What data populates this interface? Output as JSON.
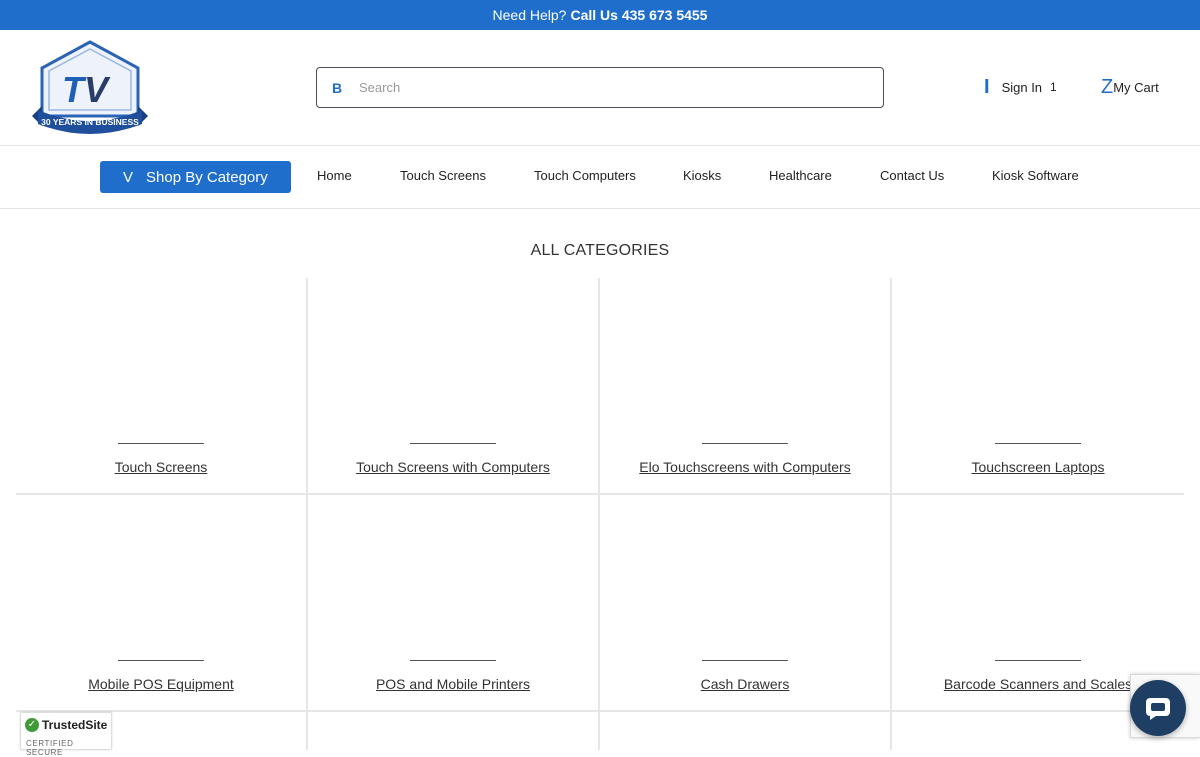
{
  "topbar": {
    "help_text": "Need Help?",
    "phone_text": "Call Us 435 673 5455"
  },
  "header": {
    "logo_text": "30 YEARS IN BUSINESS",
    "search": {
      "icon_glyph": "B",
      "placeholder": "Search"
    },
    "signin": {
      "icon_glyph": "I",
      "label": "Sign In",
      "count": "1"
    },
    "cart": {
      "icon_glyph": "Z",
      "label": "My Cart"
    }
  },
  "nav": {
    "shop_button": {
      "icon_glyph": "V",
      "label": "Shop By Category"
    },
    "links": [
      "Home",
      "Touch Screens",
      "Touch Computers",
      "Kiosks",
      "Healthcare",
      "Contact Us",
      "Kiosk Software"
    ]
  },
  "main": {
    "heading": "ALL CATEGORIES",
    "categories": [
      "Touch Screens",
      "Touch Screens with Computers",
      "Elo Touchscreens with Computers",
      "Touchscreen Laptops",
      "Mobile POS Equipment",
      "POS and Mobile Printers",
      "Cash Drawers",
      "Barcode Scanners and Scales"
    ]
  },
  "badges": {
    "trusted_title": "TrustedSite",
    "trusted_sub": "CERTIFIED SECURE"
  },
  "colors": {
    "brand_blue": "#1f6ecb",
    "chat_navy": "#1e3f63"
  }
}
